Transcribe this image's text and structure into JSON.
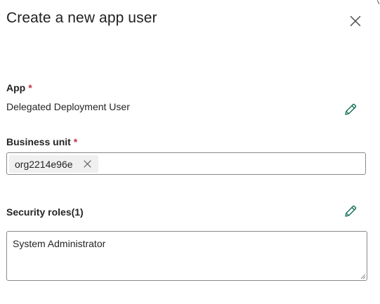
{
  "panel": {
    "title": "Create a new app user",
    "close_icon": "close-icon"
  },
  "app": {
    "label": "App",
    "required_marker": "*",
    "value": "Delegated Deployment User",
    "edit_icon": "pencil-icon"
  },
  "business_unit": {
    "label": "Business unit",
    "required_marker": "*",
    "selected_tag": "org2214e96e",
    "remove_icon": "close-icon"
  },
  "security_roles": {
    "label": "Security roles(1)",
    "value": "System Administrator",
    "edit_icon": "pencil-icon"
  },
  "colors": {
    "accent_green": "#0f6e56",
    "required_red": "#c4314b",
    "border": "#8a8a8a"
  }
}
